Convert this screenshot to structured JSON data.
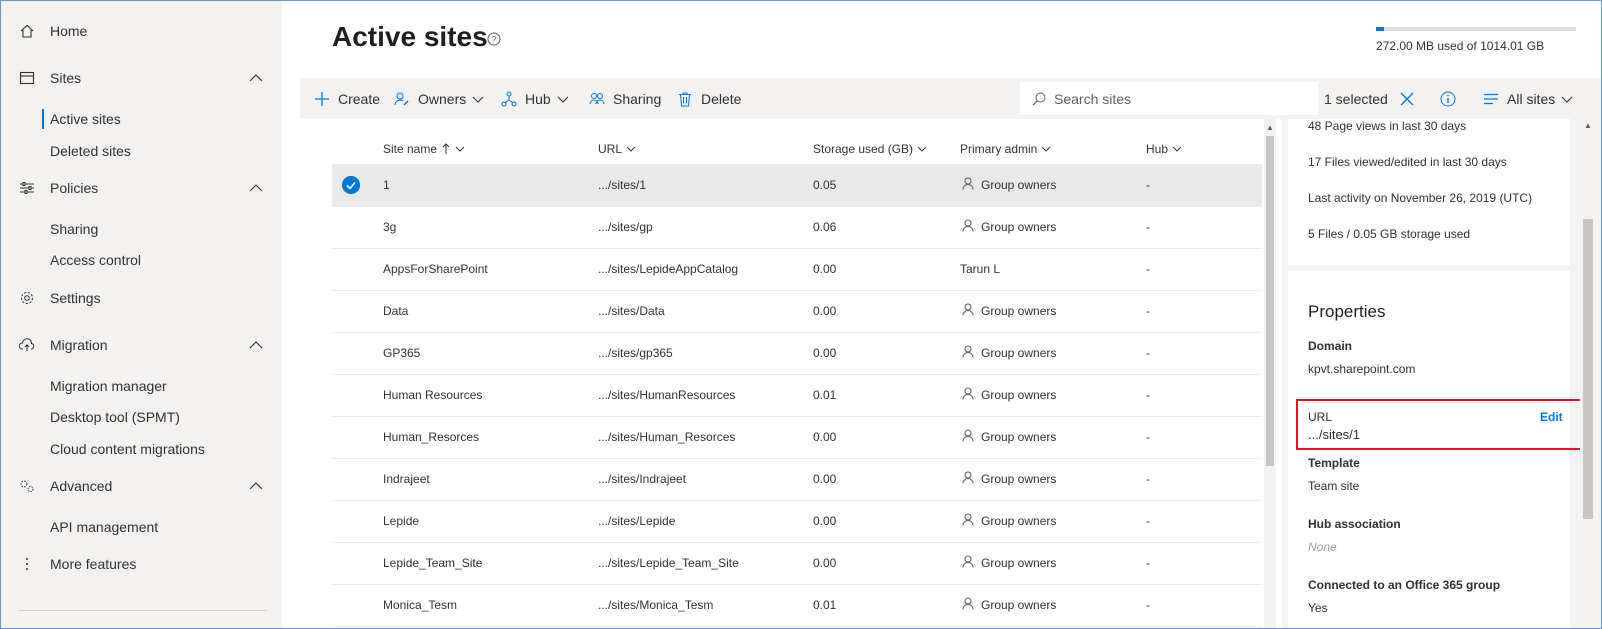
{
  "sidebar": {
    "home": "Home",
    "sites": "Sites",
    "active_sites": "Active sites",
    "deleted_sites": "Deleted sites",
    "policies": "Policies",
    "sharing": "Sharing",
    "access_control": "Access control",
    "settings": "Settings",
    "migration": "Migration",
    "migration_manager": "Migration manager",
    "desktop_tool": "Desktop tool (SPMT)",
    "cloud_migrations": "Cloud content migrations",
    "advanced": "Advanced",
    "api_management": "API management",
    "more_features": "More features"
  },
  "header": {
    "title": "Active sites",
    "storage_text": "272.00 MB used of 1014.01 GB",
    "storage_fraction": 0.0003
  },
  "toolbar": {
    "create": "Create",
    "owners": "Owners",
    "hub": "Hub",
    "sharing": "Sharing",
    "delete": "Delete",
    "search_placeholder": "Search sites",
    "selected": "1 selected",
    "view": "All sites"
  },
  "table": {
    "columns": {
      "site_name": "Site name",
      "url": "URL",
      "storage": "Storage used (GB)",
      "admin": "Primary admin",
      "hub": "Hub"
    },
    "rows": [
      {
        "name": "1",
        "url": ".../sites/1",
        "storage": "0.05",
        "admin": "Group owners",
        "hub": "-"
      },
      {
        "name": "3g",
        "url": ".../sites/gp",
        "storage": "0.06",
        "admin": "Group owners",
        "hub": "-"
      },
      {
        "name": "AppsForSharePoint",
        "url": ".../sites/LepideAppCatalog",
        "storage": "0.00",
        "admin": "Tarun L",
        "hub": "-"
      },
      {
        "name": "Data",
        "url": ".../sites/Data",
        "storage": "0.00",
        "admin": "Group owners",
        "hub": "-"
      },
      {
        "name": "GP365",
        "url": ".../sites/gp365",
        "storage": "0.00",
        "admin": "Group owners",
        "hub": "-"
      },
      {
        "name": "Human Resources",
        "url": ".../sites/HumanResources",
        "storage": "0.01",
        "admin": "Group owners",
        "hub": "-"
      },
      {
        "name": "Human_Resorces",
        "url": ".../sites/Human_Resorces",
        "storage": "0.00",
        "admin": "Group owners",
        "hub": "-"
      },
      {
        "name": "Indrajeet",
        "url": ".../sites/Indrajeet",
        "storage": "0.00",
        "admin": "Group owners",
        "hub": "-"
      },
      {
        "name": "Lepide",
        "url": ".../sites/Lepide",
        "storage": "0.00",
        "admin": "Group owners",
        "hub": "-"
      },
      {
        "name": "Lepide_Team_Site",
        "url": ".../sites/Lepide_Team_Site",
        "storage": "0.00",
        "admin": "Group owners",
        "hub": "-"
      },
      {
        "name": "Monica_Tesm",
        "url": ".../sites/Monica_Tesm",
        "storage": "0.01",
        "admin": "Group owners",
        "hub": "-"
      }
    ]
  },
  "panel": {
    "stats": [
      "48 Page views in last 30 days",
      "17 Files viewed/edited in last 30 days",
      "Last activity on November 26, 2019 (UTC)",
      "5 Files / 0.05 GB storage used"
    ],
    "properties_title": "Properties",
    "domain_label": "Domain",
    "domain_value": "kpvt.sharepoint.com",
    "url_label": "URL",
    "url_value": ".../sites/1",
    "edit": "Edit",
    "template_label": "Template",
    "template_value": "Team site",
    "hub_label": "Hub association",
    "hub_value": "None",
    "group_label": "Connected to an Office 365 group",
    "group_value": "Yes"
  }
}
